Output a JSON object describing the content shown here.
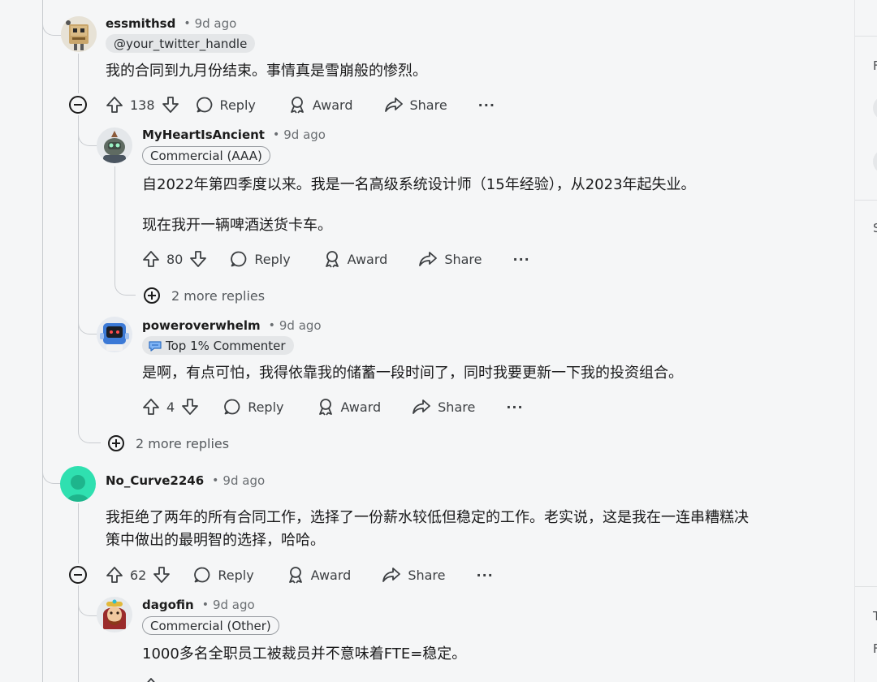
{
  "comments": [
    {
      "username": "essmithsd",
      "time": "9d ago",
      "flair": "@your_twitter_handle",
      "body": [
        "我的合同到九月份结束。事情真是雪崩般的惨烈。"
      ],
      "votes": "138"
    },
    {
      "username": "MyHeartIsAncient",
      "time": "9d ago",
      "flair": "Commercial (AAA)",
      "body": [
        "自2022年第四季度以来。我是一名高级系统设计师（15年经验），从2023年起失业。",
        "现在我开一辆啤酒送货卡车。"
      ],
      "votes": "80"
    },
    {
      "username": "poweroverwhelm",
      "time": "9d ago",
      "flair": "Top 1% Commenter",
      "body": [
        "是啊，有点可怕，我得依靠我的储蓄一段时间了，同时我要更新一下我的投资组合。"
      ],
      "votes": "4"
    },
    {
      "username": "No_Curve2246",
      "time": "9d ago",
      "flair": "",
      "body": [
        "我拒绝了两年的所有合同工作，选择了一份薪水较低但稳定的工作。老实说，这是我在一连串糟糕决",
        "策中做出的最明智的选择，哈哈。"
      ],
      "votes": "62"
    },
    {
      "username": "dagofin",
      "time": "9d ago",
      "flair": "Commercial (Other)",
      "body": [
        "1000多名全职员工被裁员并不意味着FTE=稳定。"
      ],
      "votes": ""
    }
  ],
  "actions": {
    "reply": "Reply",
    "award": "Award",
    "share": "Share",
    "more": "···"
  },
  "more_replies": {
    "inner": "2 more replies",
    "outer": "2 more replies"
  },
  "sidebar": {
    "letters": [
      "F",
      "S",
      "T",
      "F"
    ]
  },
  "colors": {
    "background": "#f5f6f7",
    "thread_line": "#c9ccd0",
    "flair_fill": "#e4e6e8",
    "avatar_teal": "#2fe0b0"
  }
}
